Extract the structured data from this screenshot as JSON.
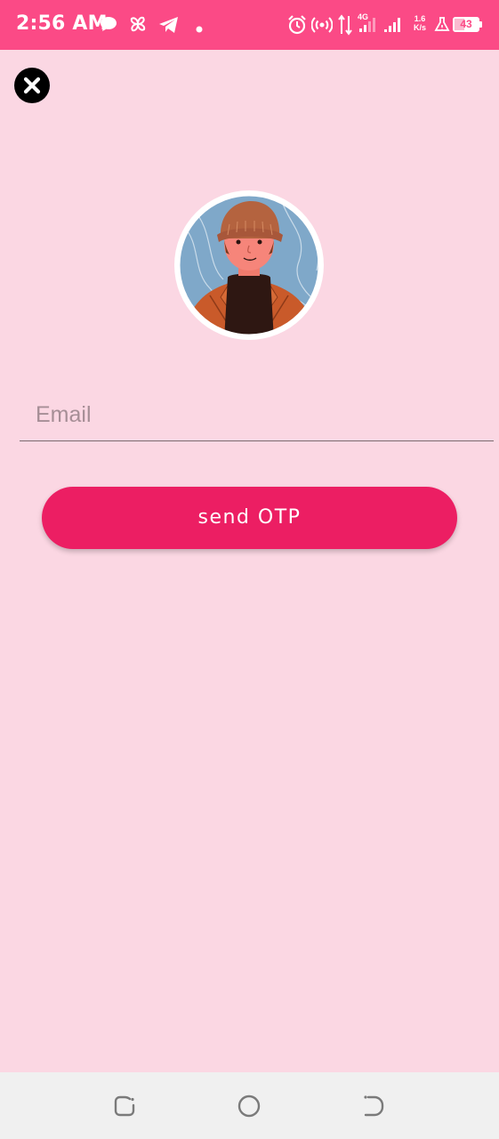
{
  "status_bar": {
    "time": "2:56 AM",
    "network_type": "4G",
    "net_speed_value": "1.6",
    "net_speed_unit": "K/s",
    "battery_level": "43",
    "colors": {
      "background": "#fb4a86",
      "foreground": "#ffffff"
    },
    "icons": [
      "chat-bubble-icon",
      "pinwheel-icon",
      "telegram-icon",
      "notification-dot-icon",
      "alarm-icon",
      "hotspot-icon",
      "data-arrows-icon",
      "signal-icon",
      "signal-icon",
      "vpn-flask-icon",
      "battery-icon"
    ]
  },
  "close_button": {
    "icon": "close-icon"
  },
  "avatar": {
    "icon": "user-avatar-illustration"
  },
  "email": {
    "placeholder": "Email",
    "value": ""
  },
  "send_button": {
    "label": "send OTP"
  },
  "nav_bar": {
    "items": [
      "recent-apps-icon",
      "home-icon",
      "back-icon"
    ]
  },
  "colors": {
    "page_background": "#fbd7e3",
    "accent": "#ec1e63",
    "nav_background": "#f0f0f0"
  }
}
